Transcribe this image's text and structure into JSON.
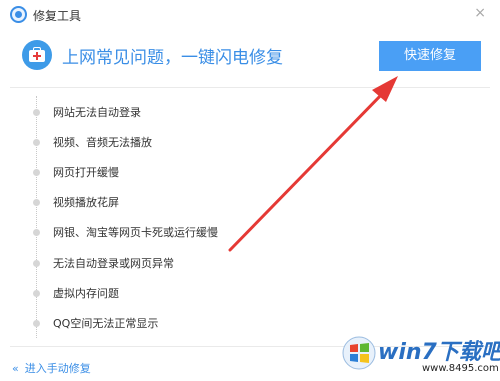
{
  "window": {
    "title": "修复工具",
    "close_glyph": "×"
  },
  "header": {
    "icon": "first-aid-kit-icon",
    "headline": "上网常见问题，一键闪电修复",
    "fix_button_label": "快速修复",
    "accent_color": "#3a8ee6",
    "button_color": "#4a9ff5"
  },
  "issues": [
    "网站无法自动登录",
    "视频、音频无法播放",
    "网页打开缓慢",
    "视频播放花屏",
    "网银、淘宝等网页卡死或运行缓慢",
    "无法自动登录或网页异常",
    "虚拟内存问题",
    "QQ空间无法正常显示"
  ],
  "footer": {
    "manual_link_chevron": "«",
    "manual_link_label": "进入手动修复"
  },
  "annotation": {
    "arrow_color": "#e53935"
  },
  "watermark": {
    "brand": "win7下载吧",
    "url": "www.8495.com"
  }
}
